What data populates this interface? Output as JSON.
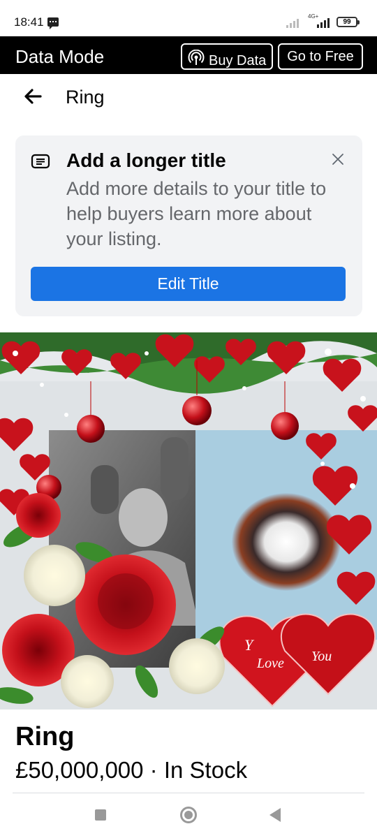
{
  "status_bar": {
    "time": "18:41",
    "network": "4G+",
    "battery": "99"
  },
  "data_mode": {
    "title": "Data Mode",
    "buy_data_label": "Buy Data",
    "go_free_label": "Go to Free"
  },
  "header": {
    "title": "Ring"
  },
  "banner": {
    "title": "Add a longer title",
    "body": "Add more details to your title to help buyers learn more about your listing.",
    "button_label": "Edit Title",
    "icon": "text-lines-icon",
    "close_icon": "close-icon"
  },
  "photo": {
    "heart_text_1": "Y",
    "heart_text_2": "Love",
    "heart_text_3": "You"
  },
  "listing": {
    "title": "Ring",
    "price_status": "£50,000,000 · In Stock"
  },
  "colors": {
    "accent": "#1b74e4",
    "banner_bg": "#f2f3f5",
    "secondary_text": "#65676b"
  }
}
